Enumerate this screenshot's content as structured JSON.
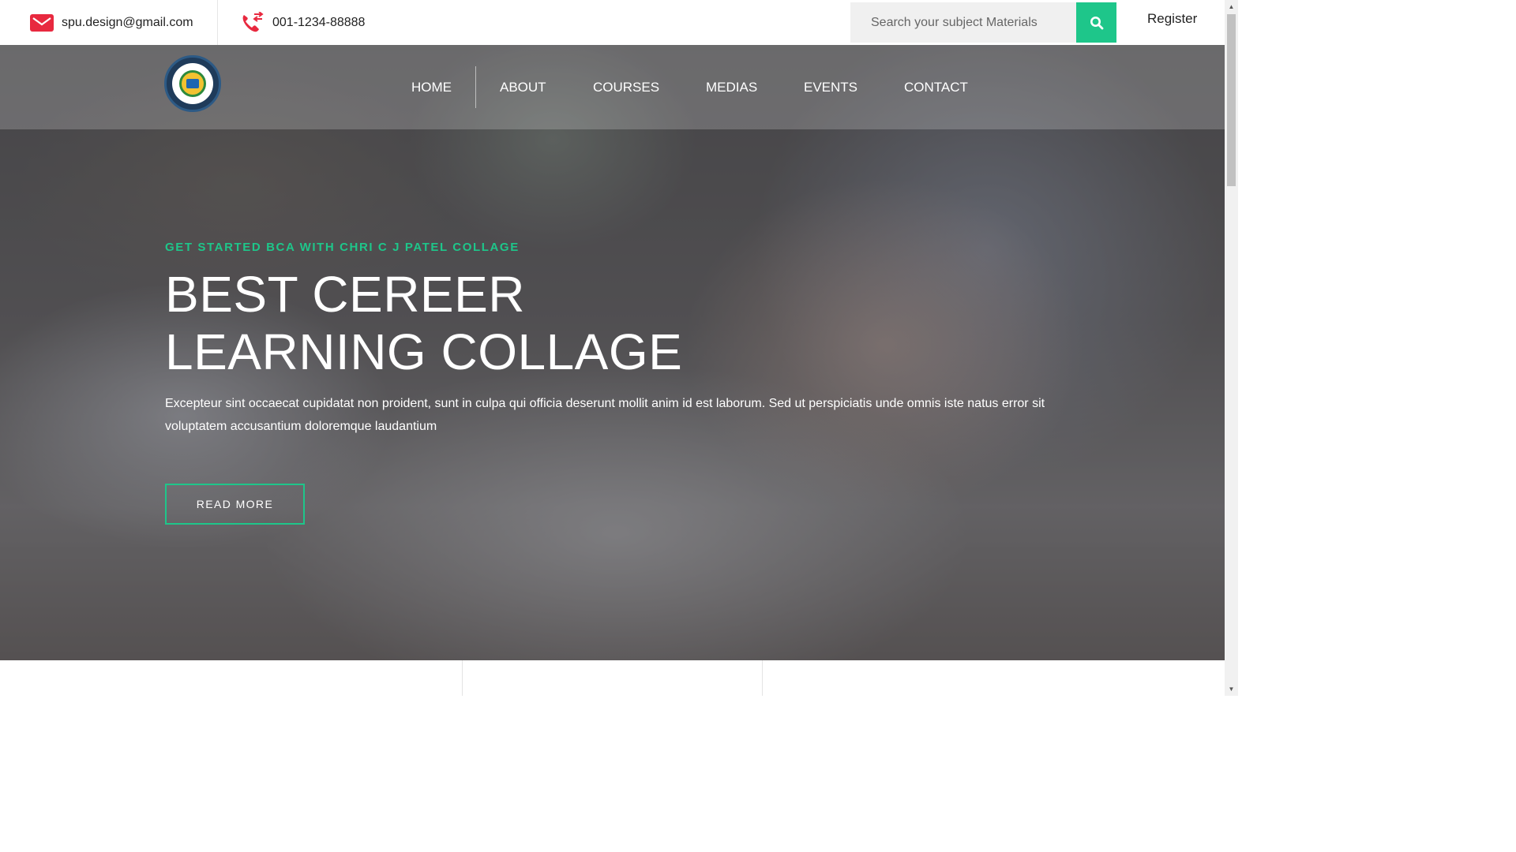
{
  "topbar": {
    "email": "spu.design@gmail.com",
    "email_icon": "mail-icon",
    "phone": "001-1234-88888",
    "phone_icon": "phone-icon",
    "search_placeholder": "Search your subject Materials",
    "search_icon": "search-icon",
    "register_label": "Register"
  },
  "nav": {
    "logo_icon": "college-logo",
    "items": [
      "HOME",
      "ABOUT",
      "COURSES",
      "MEDIAS",
      "EVENTS",
      "CONTACT"
    ]
  },
  "hero": {
    "kicker": "GET STARTED BCA WITH CHRI C J PATEL COLLAGE",
    "title_line1": "BEST CEREER",
    "title_line2": "LEARNING COLLAGE",
    "description": "Excepteur sint occaecat cupidatat non proident, sunt in culpa qui officia deserunt mollit anim id est laborum. Sed ut perspiciatis unde omnis iste natus error sit voluptatem accusantium doloremque laudantium",
    "button_label": "READ MORE"
  },
  "colors": {
    "accent": "#1ec68a",
    "icon_red": "#e8293f"
  }
}
